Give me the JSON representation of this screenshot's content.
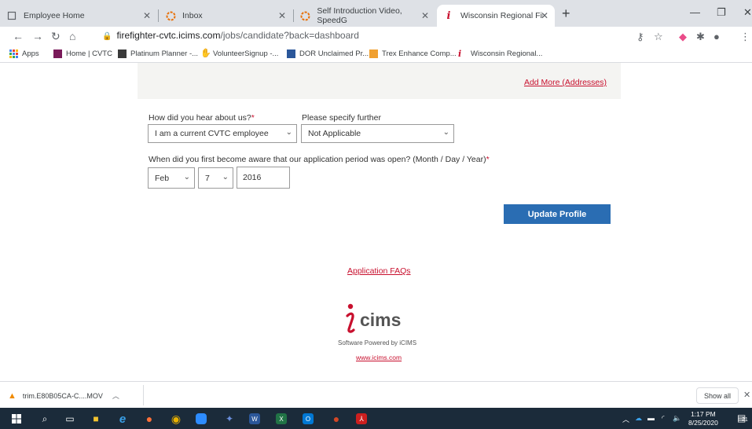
{
  "browser": {
    "tabs": [
      {
        "title": "Employee Home",
        "icon": "page-icon"
      },
      {
        "title": "Inbox",
        "icon": "webmail-icon"
      },
      {
        "title": "Self Introduction Video, SpeedG",
        "icon": "webmail-icon"
      },
      {
        "title": "Wisconsin Regional Fire Departm",
        "icon": "icims-icon"
      }
    ],
    "url_host": "firefighter-cvtc.icims.com",
    "url_path": "/jobs/candidate?back=dashboard",
    "bookmarks": [
      {
        "label": "Apps"
      },
      {
        "label": "Home | CVTC"
      },
      {
        "label": "Platinum Planner -..."
      },
      {
        "label": "VolunteerSignup -..."
      },
      {
        "label": "DOR Unclaimed Pr..."
      },
      {
        "label": "Trex Enhance Comp..."
      },
      {
        "label": "Wisconsin Regional..."
      }
    ]
  },
  "page": {
    "add_more_link": "Add More (Addresses)",
    "hear_label": "How did you hear about us?",
    "hear_value": "I am a current CVTC employee",
    "specify_label": "Please specify further",
    "specify_value": "Not Applicable",
    "aware_label": "When did you first become aware that our application period was open? (Month / Day / Year)",
    "required_marker": "*",
    "month_value": "Feb",
    "day_value": "7",
    "year_value": "2016",
    "update_button": "Update Profile",
    "faq_link": "Application FAQs",
    "powered_by": "Software Powered by iCIMS",
    "icims_url": "www.icims.com",
    "logo_text": "cims"
  },
  "download_bar": {
    "file_name": "trim.E80B05CA-C....MOV",
    "show_all": "Show all"
  },
  "taskbar": {
    "time": "1:17 PM",
    "date": "8/25/2020",
    "notification_count": "21"
  },
  "colors": {
    "accent_red": "#c8102e",
    "button_blue": "#2a6db3",
    "taskbar": "#1b2b3a"
  }
}
